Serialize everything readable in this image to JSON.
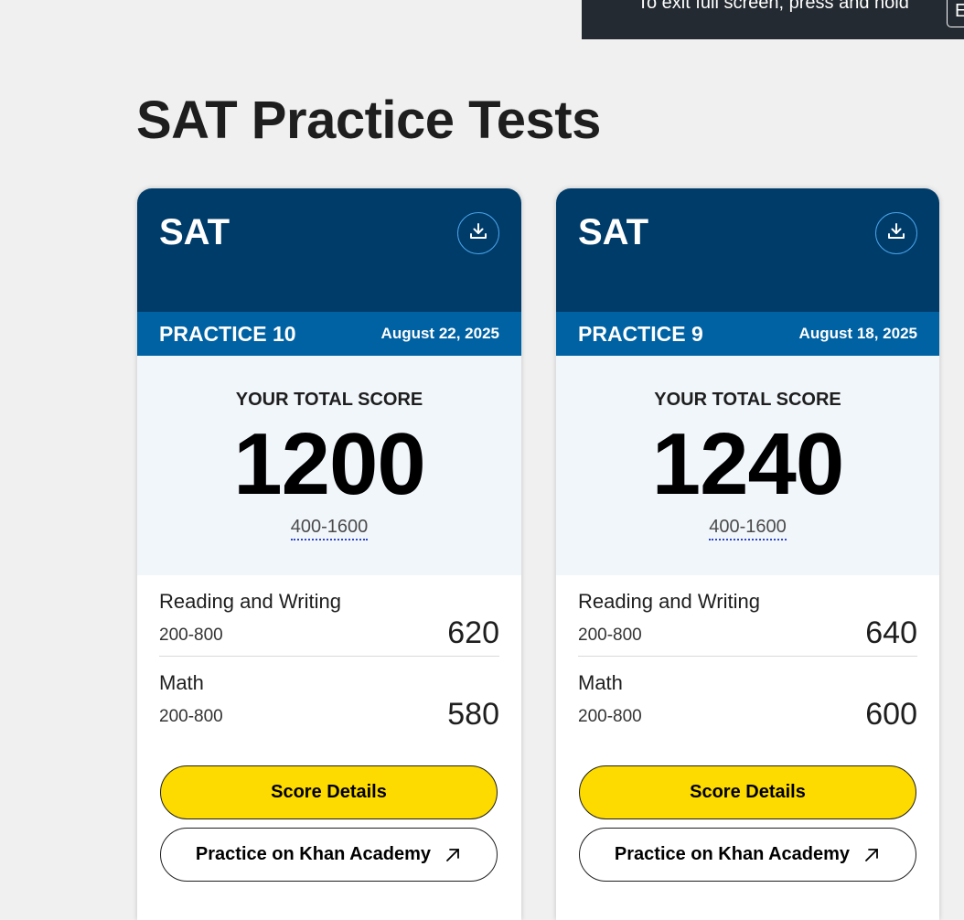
{
  "fullscreen_notice": {
    "text": "To exit full screen, press and hold",
    "key": "Esc"
  },
  "page": {
    "title": "SAT Practice Tests"
  },
  "cards": [
    {
      "test_name": "SAT",
      "download_icon": "download-icon",
      "practice": "PRACTICE 10",
      "date": "August 22, 2025",
      "total_label": "YOUR TOTAL SCORE",
      "total_score": "1200",
      "total_range": "400-1600",
      "sections": [
        {
          "name": "Reading and Writing",
          "range": "200-800",
          "score": "620"
        },
        {
          "name": "Math",
          "range": "200-800",
          "score": "580"
        }
      ],
      "score_details_label": "Score Details",
      "khan_label": "Practice on Khan Academy",
      "external_icon": "external-link-icon"
    },
    {
      "test_name": "SAT",
      "download_icon": "download-icon",
      "practice": "PRACTICE 9",
      "date": "August 18, 2025",
      "total_label": "YOUR TOTAL SCORE",
      "total_score": "1240",
      "total_range": "400-1600",
      "sections": [
        {
          "name": "Reading and Writing",
          "range": "200-800",
          "score": "640"
        },
        {
          "name": "Math",
          "range": "200-800",
          "score": "600"
        }
      ],
      "score_details_label": "Score Details",
      "khan_label": "Practice on Khan Academy",
      "external_icon": "external-link-icon"
    }
  ],
  "colors": {
    "card_header": "#003c6a",
    "practice_bar": "#0062a3",
    "primary_button": "#fedb00",
    "score_panel": "#f1f6fb"
  }
}
